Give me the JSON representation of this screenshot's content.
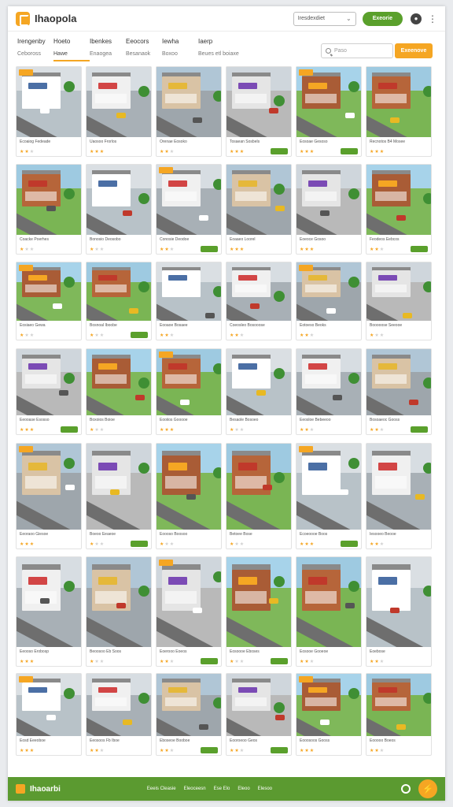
{
  "header": {
    "brand": "Ihaopola",
    "select_label": "Iresdexdiet",
    "primary_button": "Exeorie",
    "menu_icon": "kebab-icon"
  },
  "nav": {
    "tabs": [
      "Irengenby",
      "Hoeto",
      "Ibenkes",
      "Eeocors",
      "Iewha",
      "Iaerp"
    ],
    "subtabs": [
      "Ceboross",
      "Hawe",
      "Enaogea",
      "Besanaok",
      "Boxoo",
      "Beues etl boiaxe"
    ],
    "active_subtab": 1,
    "search_placeholder": "Paso",
    "search_button": "Exeenove"
  },
  "colors": {
    "accent": "#f5a623",
    "brand_green": "#5aa02c",
    "footer_green": "#5b9a30"
  },
  "cards": [
    {
      "c": "Ecoaiog Fedeade",
      "r": 2
    },
    {
      "c": "Uaosoo Frorlos",
      "r": 3
    },
    {
      "c": "Orenae Eosoko",
      "r": 2
    },
    {
      "c": "Tosaean Sosbels",
      "r": 3
    },
    {
      "c": "Eosoae Gesoso",
      "r": 3
    },
    {
      "c": "Recnotos B4 Mosee",
      "r": 3
    },
    {
      "c": "Coacke Poerhes",
      "r": 1
    },
    {
      "c": "Bonosio Deosobo",
      "r": 1
    },
    {
      "c": "Conosie Deodoe",
      "r": 2
    },
    {
      "c": "Eoaaeo Loorel",
      "r": 4
    },
    {
      "c": "Eoeoce Gosoo",
      "r": 3
    },
    {
      "c": "Feodeos Eebcos",
      "r": 2
    },
    {
      "c": "Eosiaeo Gewa",
      "r": 1
    },
    {
      "c": "Bosnoal Iboobe",
      "r": 1
    },
    {
      "c": "Eooaoe Bosaee",
      "r": 2
    },
    {
      "c": "Coeosleo Bosooose",
      "r": 2
    },
    {
      "c": "Eotoeso Beoks",
      "r": 2
    },
    {
      "c": "Booooose Seeooe",
      "r": 1
    },
    {
      "c": "Eeooase Esosso",
      "r": 3
    },
    {
      "c": "Boxoios Boioe",
      "r": 1
    },
    {
      "c": "Eooiios Gooooe",
      "r": 3
    },
    {
      "c": "Besaole Bosoeo",
      "r": 1
    },
    {
      "c": "Eeosloe Bebeeoo",
      "r": 2
    },
    {
      "c": "Bosoaeoc Gooss",
      "r": 2
    },
    {
      "c": "Eeoraoo Giesoe",
      "r": 3
    },
    {
      "c": "Boeoo Eeaeoe",
      "r": 1
    },
    {
      "c": "Eoooso Boosoo",
      "r": 1
    },
    {
      "c": "Betoee Bose",
      "r": 1
    },
    {
      "c": "Ecoeoooe Boos",
      "r": 3
    },
    {
      "c": "Iesooeo Beooe",
      "r": 2
    },
    {
      "c": "Eeooso Erobosp",
      "r": 3
    },
    {
      "c": "Beoosoo Eb Soos",
      "r": 1
    },
    {
      "c": "Eoerooo Eoeos",
      "r": 2
    },
    {
      "c": "Eosoooe Eboses",
      "r": 1
    },
    {
      "c": "Eosooe Gooeoe",
      "r": 2
    },
    {
      "c": "Eoebose",
      "r": 2
    },
    {
      "c": "Eosd Eeeoboe",
      "r": 3
    },
    {
      "c": "Eeosoos Fb Iboe",
      "r": 2
    },
    {
      "c": "Eboseoe Booboe",
      "r": 2
    },
    {
      "c": "Eooroeoo Geos",
      "r": 2
    },
    {
      "c": "Eooosoos Gooss",
      "r": 3
    },
    {
      "c": "Eooooo Boeos",
      "r": 2
    }
  ],
  "footer": {
    "brand": "Ihaoarbi",
    "links": [
      "Eeeis Cleasie",
      "Eleoceesn",
      "Ese Elo",
      "Eleoo",
      "Elesoo"
    ]
  }
}
